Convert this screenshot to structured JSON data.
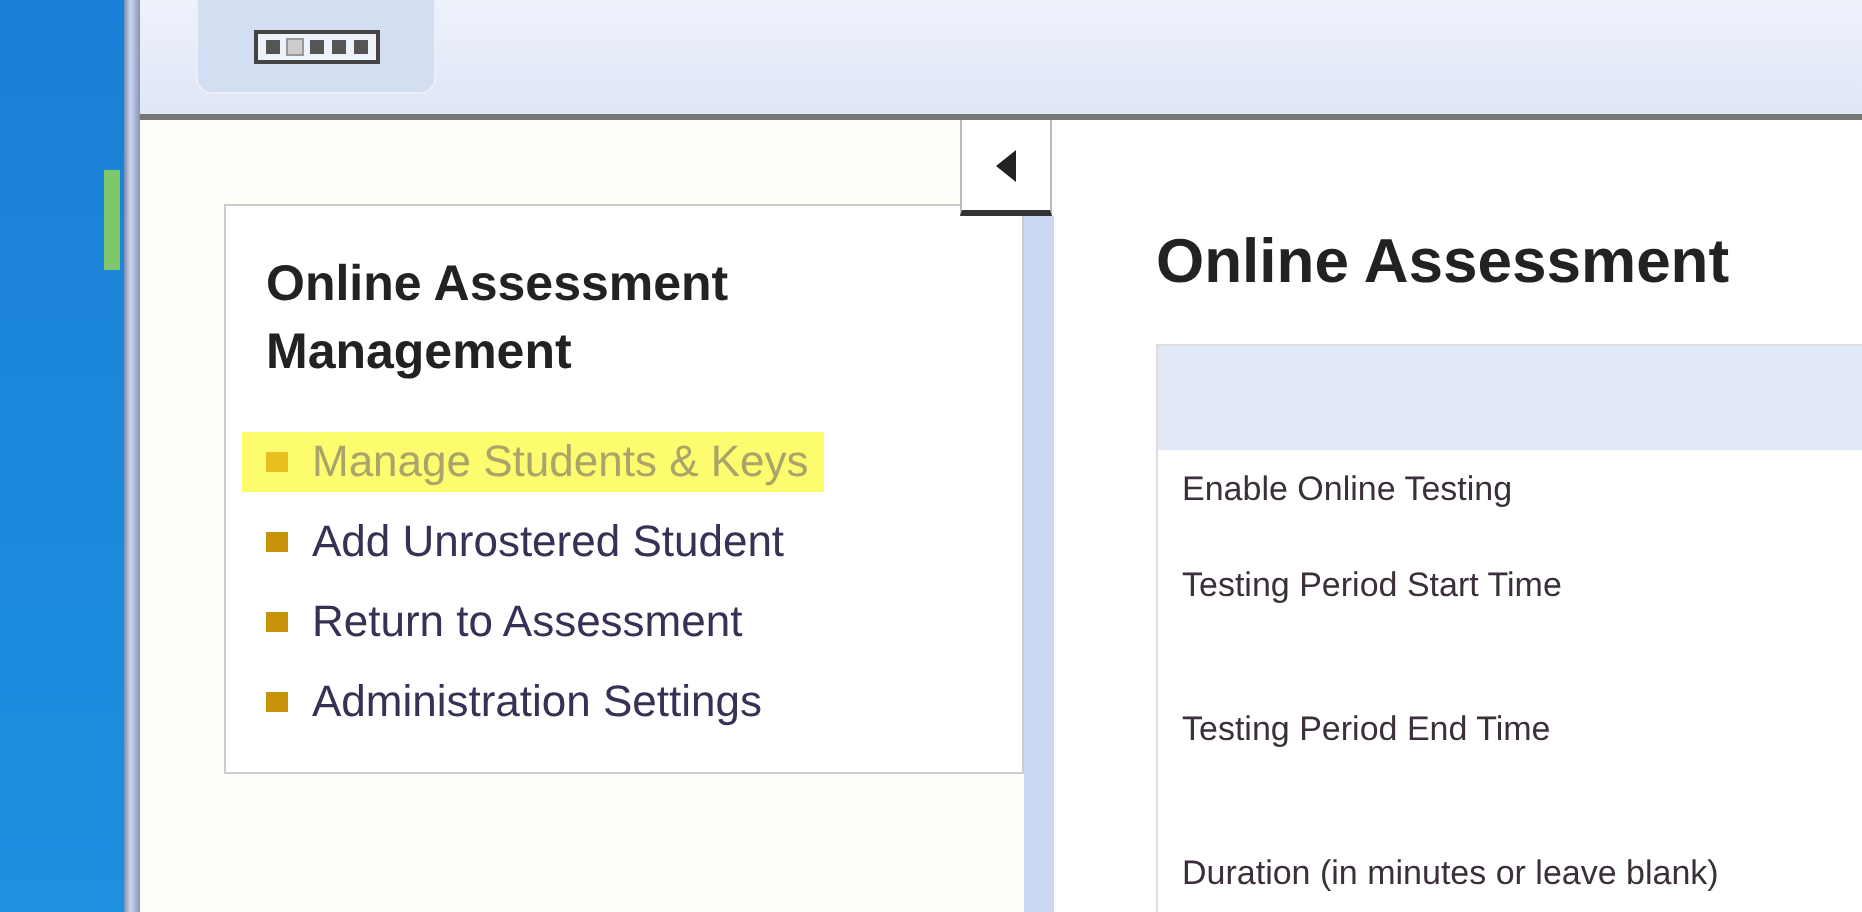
{
  "toolbar": {
    "pager": [
      {
        "selected": false
      },
      {
        "selected": true
      },
      {
        "selected": false
      },
      {
        "selected": false
      },
      {
        "selected": false
      }
    ]
  },
  "sidebar": {
    "title": "Online Assessment Management",
    "items": [
      {
        "label": "Manage Students & Keys",
        "highlighted": true
      },
      {
        "label": "Add Unrostered Student",
        "highlighted": false
      },
      {
        "label": "Return to Assessment",
        "highlighted": false
      },
      {
        "label": "Administration Settings",
        "highlighted": false
      }
    ]
  },
  "main": {
    "title": "Online Assessment",
    "form_rows": [
      {
        "label": "Enable Online Testing"
      },
      {
        "label": "Testing Period Start Time"
      },
      {
        "label": "Testing Period End Time"
      },
      {
        "label": "Duration (in minutes or leave blank)"
      }
    ]
  }
}
